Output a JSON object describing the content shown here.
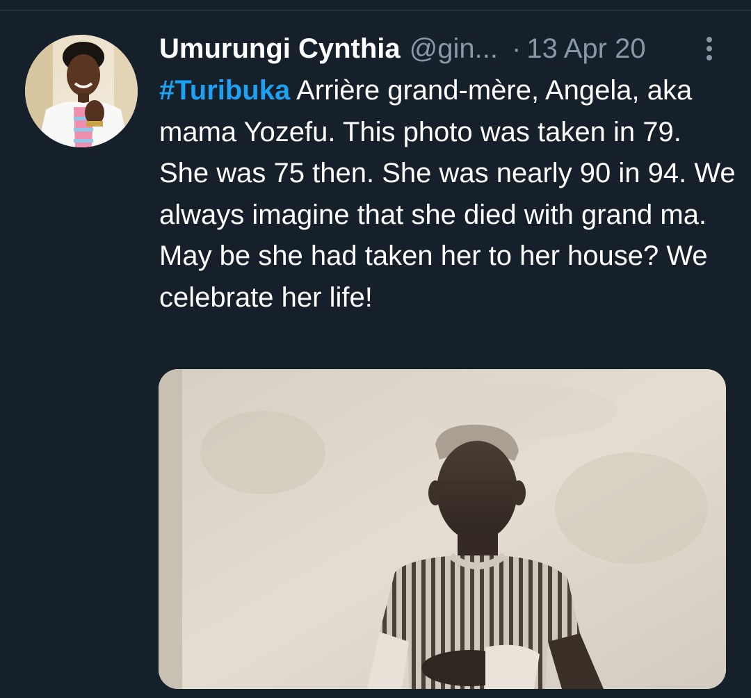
{
  "tweet": {
    "author": {
      "display_name": "Umurungi Cynthia",
      "handle": "@gin..."
    },
    "separator": "·",
    "timestamp": "13 Apr 20",
    "hashtag": "#Turibuka",
    "body": " Arrière grand-mère, Angela, aka mama Yozefu. This photo was taken in 79. She was 75 then. She was nearly 90 in 94. We always imagine that she died with grand ma. May be she had taken her to her house? We celebrate her life!",
    "media": {
      "type": "photo"
    }
  },
  "icons": {
    "more": "vertical-dots-icon"
  },
  "colors": {
    "background": "#15202b",
    "hashtag": "#1da1f2",
    "secondary_text": "#8899a6",
    "primary_text": "#ffffff"
  }
}
